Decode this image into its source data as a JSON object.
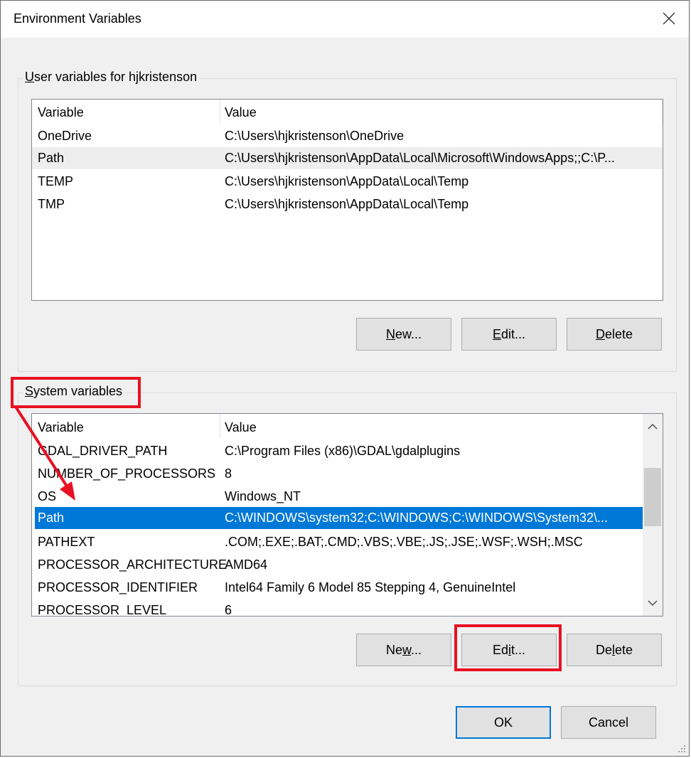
{
  "window": {
    "title": "Environment Variables",
    "close_icon": "close-icon"
  },
  "user_vars": {
    "label_access": "U",
    "label_rest": "ser variables for hjkristenson",
    "columns": {
      "variable": "Variable",
      "value": "Value"
    },
    "rows": [
      {
        "name": "OneDrive",
        "value": "C:\\Users\\hjkristenson\\OneDrive"
      },
      {
        "name": "Path",
        "value": "C:\\Users\\hjkristenson\\AppData\\Local\\Microsoft\\WindowsApps;;C:\\P..."
      },
      {
        "name": "TEMP",
        "value": "C:\\Users\\hjkristenson\\AppData\\Local\\Temp"
      },
      {
        "name": "TMP",
        "value": "C:\\Users\\hjkristenson\\AppData\\Local\\Temp"
      }
    ],
    "buttons": {
      "new_access": "N",
      "new_rest": "ew...",
      "edit_access": "E",
      "edit_rest": "dit...",
      "delete_access": "D",
      "delete_rest": "elete"
    }
  },
  "system_vars": {
    "label_access": "S",
    "label_rest": "ystem variables",
    "columns": {
      "variable": "Variable",
      "value": "Value"
    },
    "rows": [
      {
        "name": "GDAL_DRIVER_PATH",
        "value": "C:\\Program Files (x86)\\GDAL\\gdalplugins"
      },
      {
        "name": "NUMBER_OF_PROCESSORS",
        "value": "8"
      },
      {
        "name": "OS",
        "value": "Windows_NT"
      },
      {
        "name": "Path",
        "value": "C:\\WINDOWS\\system32;C:\\WINDOWS;C:\\WINDOWS\\System32\\..."
      },
      {
        "name": "PATHEXT",
        "value": ".COM;.EXE;.BAT;.CMD;.VBS;.VBE;.JS;.JSE;.WSF;.WSH;.MSC"
      },
      {
        "name": "PROCESSOR_ARCHITECTURE",
        "value": "AMD64"
      },
      {
        "name": "PROCESSOR_IDENTIFIER",
        "value": "Intel64 Family 6 Model 85 Stepping 4, GenuineIntel"
      },
      {
        "name": "PROCESSOR_LEVEL",
        "value": "6"
      }
    ],
    "buttons": {
      "new_pre": "Ne",
      "new_access": "w",
      "new_post": "...",
      "edit_pre": "Ed",
      "edit_access": "i",
      "edit_post": "t...",
      "delete_pre": "De",
      "delete_access": "l",
      "delete_post": "ete"
    }
  },
  "footer": {
    "ok": "OK",
    "cancel": "Cancel"
  },
  "colors": {
    "accent": "#0078d7",
    "highlight": "#e81123"
  }
}
